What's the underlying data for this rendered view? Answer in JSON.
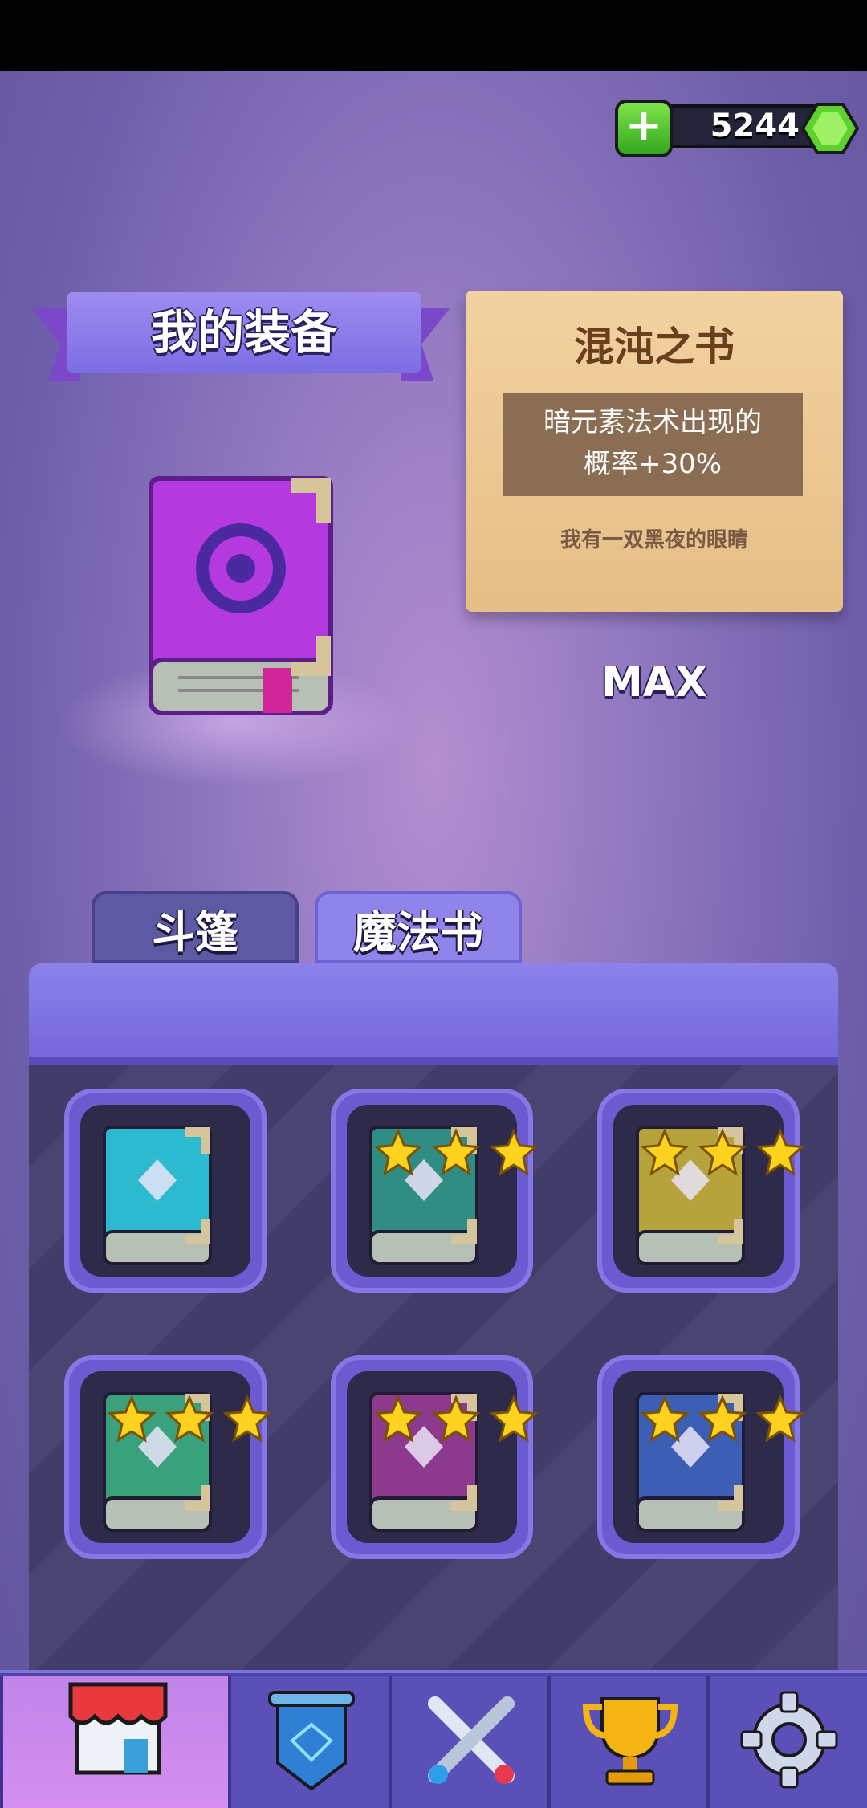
{
  "currency": {
    "amount": "5244",
    "plus_label": "+"
  },
  "title": "我的装备",
  "item_card": {
    "name": "混沌之书",
    "effect_line1": "暗元素法术出现的",
    "effect_line2": "概率+30%",
    "flavor": "我有一双黑夜的眼睛"
  },
  "level_label": "MAX",
  "tabs": [
    {
      "label": "斗篷",
      "active": false
    },
    {
      "label": "魔法书",
      "active": true
    }
  ],
  "books": [
    {
      "icon": "diamond-book-icon",
      "color": "#2bbad0",
      "stars": 0
    },
    {
      "icon": "fangs-book-icon",
      "color": "#2f8d84",
      "stars": 3
    },
    {
      "icon": "swap-book-icon",
      "color": "#b7a33c",
      "stars": 3
    },
    {
      "icon": "comet-book-icon",
      "color": "#3aa17d",
      "stars": 3
    },
    {
      "icon": "shield-book-icon",
      "color": "#8d3a8e",
      "stars": 3
    },
    {
      "icon": "crystal-book-icon",
      "color": "#3d5eb5",
      "stars": 3
    }
  ],
  "nav": [
    {
      "name": "shop",
      "active": true
    },
    {
      "name": "deck",
      "active": false
    },
    {
      "name": "battle",
      "active": false
    },
    {
      "name": "trophy",
      "active": false
    },
    {
      "name": "settings",
      "active": false
    }
  ],
  "colors": {
    "accent": "#8f84ea",
    "parchment": "#f1d2a0",
    "gem": "#7ee34a"
  }
}
